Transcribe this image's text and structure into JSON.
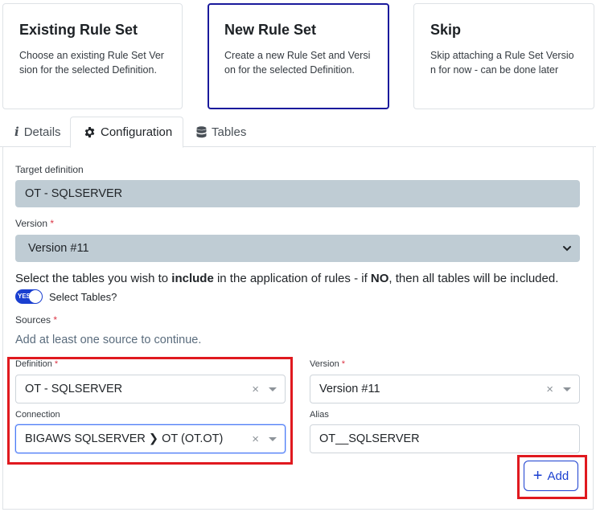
{
  "cards": [
    {
      "title": "Existing Rule Set",
      "desc": "Choose an existing Rule Set Version for the selected Definition."
    },
    {
      "title": "New Rule Set",
      "desc": "Create a new Rule Set and Version for the selected Definition."
    },
    {
      "title": "Skip",
      "desc": "Skip attaching a Rule Set Version for now - can be done later"
    }
  ],
  "tabs": {
    "details": "Details",
    "configuration": "Configuration",
    "tables": "Tables",
    "active": "Configuration"
  },
  "form": {
    "target_definition_label": "Target definition",
    "target_definition_value": "OT - SQLSERVER",
    "version_label": "Version",
    "version_value": "Version #11",
    "info_prefix": "Select the tables you wish to ",
    "info_bold1": "include",
    "info_mid": " in the application of rules - if ",
    "info_bold2": "NO",
    "info_suffix": ", then all tables will be included.",
    "toggle_state": "YES",
    "toggle_label": "Select Tables?",
    "sources_label": "Sources",
    "sources_hint": "Add at least one source to continue.",
    "definition_label": "Definition",
    "definition_value": "OT - SQLSERVER",
    "connection_label": "Connection",
    "connection_value": "BIGAWS SQLSERVER ❯ OT (OT.OT)",
    "src_version_label": "Version",
    "src_version_value": "Version #11",
    "alias_label": "Alias",
    "alias_value": "OT__SQLSERVER",
    "required_mark": "*",
    "clear_glyph": "×",
    "add_label": "Add"
  },
  "colors": {
    "accent": "#1a3fd0",
    "highlight": "#e0191f",
    "readonly_bg": "#bfccd4",
    "selected_card": "#1a1a9c"
  }
}
